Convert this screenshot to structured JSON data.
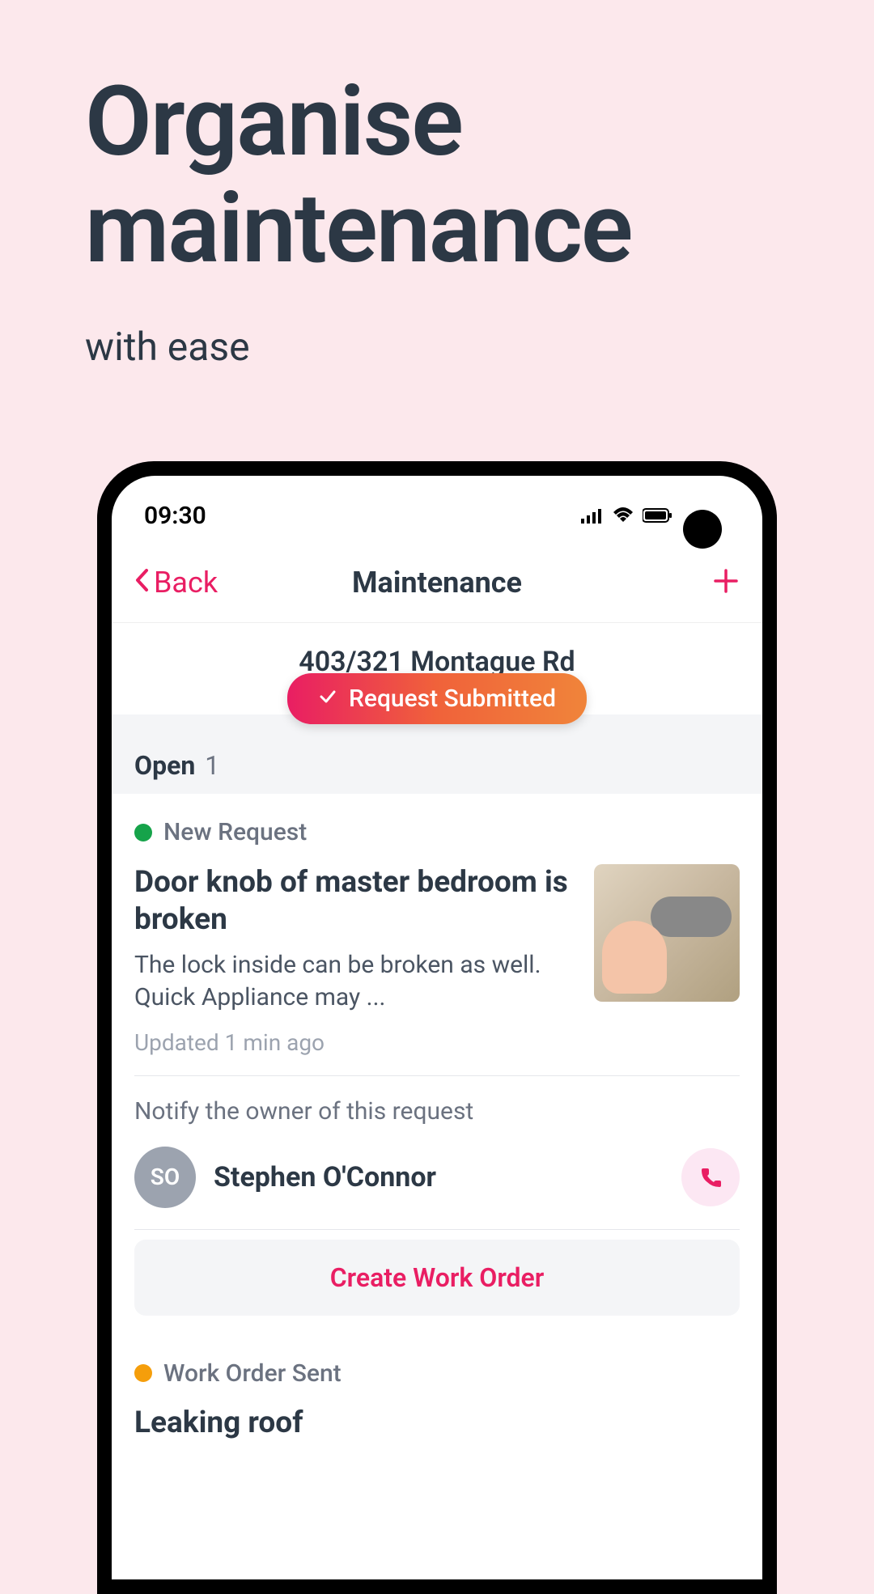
{
  "hero": {
    "title_line1": "Organise",
    "title_line2": "maintenance",
    "subtitle": "with ease"
  },
  "statusbar": {
    "time": "09:30"
  },
  "nav": {
    "back_label": "Back",
    "title": "Maintenance"
  },
  "address": "403/321 Montague Rd",
  "toast": {
    "label": "Request Submitted"
  },
  "section": {
    "label": "Open",
    "count": "1"
  },
  "request1": {
    "tag": "New Request",
    "title": "Door knob of master bedroom is broken",
    "desc": "The lock inside can be broken as well. Quick Appliance may ...",
    "updated": "Updated 1 min ago"
  },
  "notify": {
    "title": "Notify the owner of this request",
    "owner_initials": "SO",
    "owner_name": "Stephen O'Connor"
  },
  "cta": {
    "create_work_order": "Create Work Order"
  },
  "request2": {
    "tag": "Work Order Sent",
    "title": "Leaking roof"
  }
}
